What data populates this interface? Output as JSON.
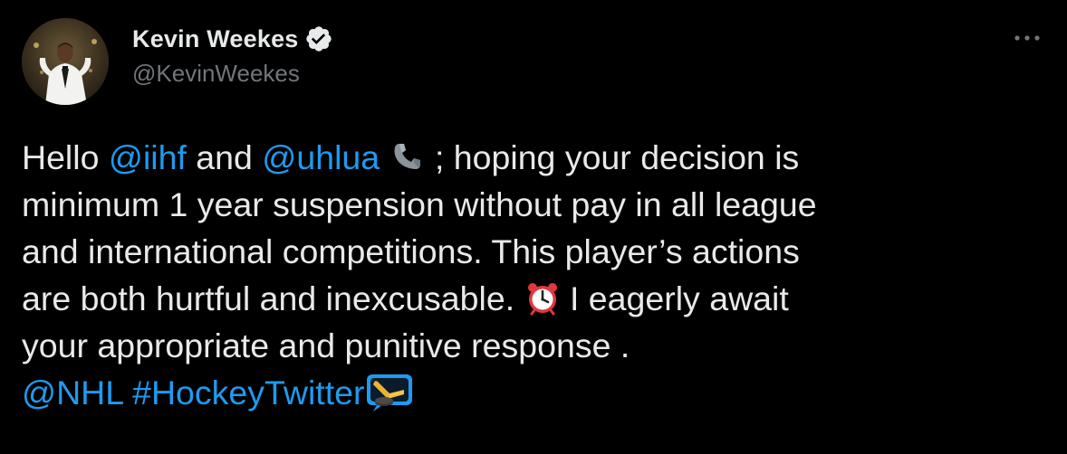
{
  "author": {
    "display_name": "Kevin Weekes",
    "handle": "@KevinWeekes",
    "verified": true
  },
  "tweet": {
    "seg_1": "Hello ",
    "mention_1": "@iihf",
    "seg_2": " and ",
    "mention_2": "@uhlua",
    "emoji_1": "telephone-receiver-icon",
    "seg_3": " ; hoping your decision is",
    "line_2": "minimum 1 year suspension without pay in all league",
    "line_3": "and international competitions. This player’s actions",
    "line_4_a": "are both hurtful and inexcusable. ",
    "emoji_2": "alarm-clock-icon",
    "line_4_b": " I eagerly await",
    "line_5": "your appropriate and punitive response .",
    "mention_3": "@NHL",
    "hashtag": "#HockeyTwitter",
    "emoji_3": "hockey-hashflag-icon"
  },
  "colors": {
    "background": "#000000",
    "text": "#e7e9ea",
    "secondary": "#71767b",
    "link": "#1d9bf0",
    "verified_badge": "#e7e9ea"
  }
}
